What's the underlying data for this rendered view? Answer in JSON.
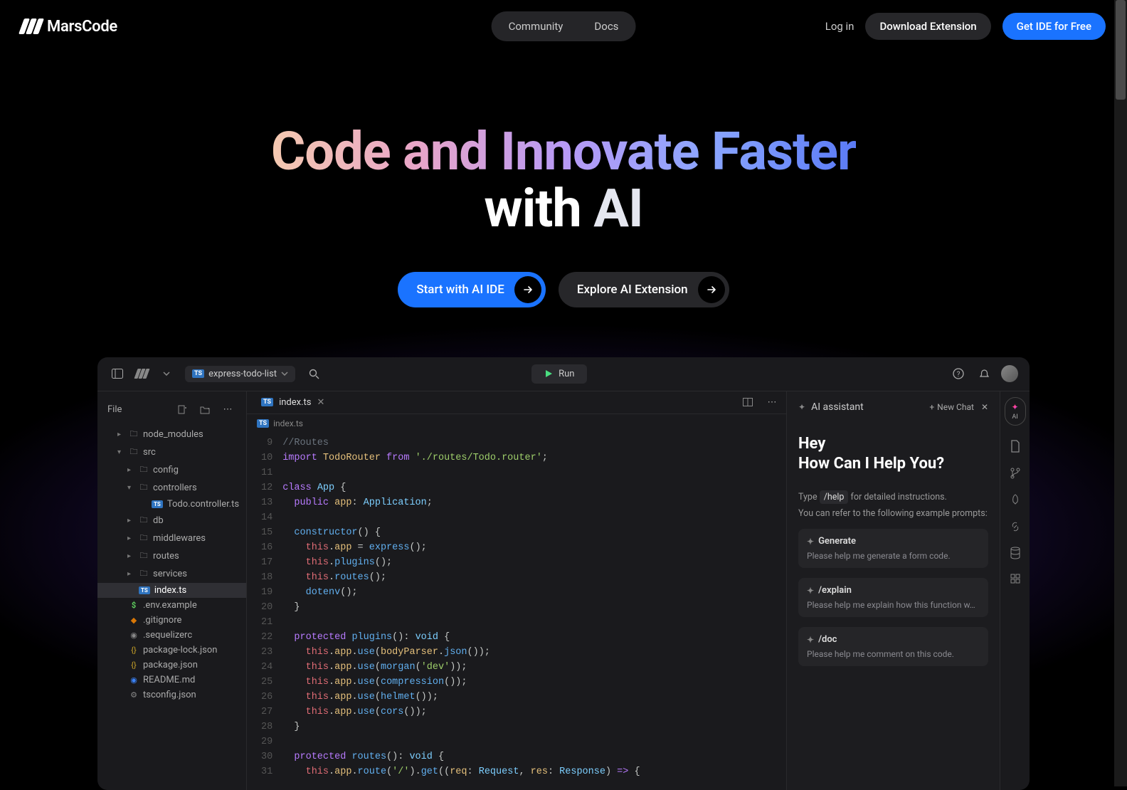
{
  "brand": "MarsCode",
  "nav": {
    "community": "Community",
    "docs": "Docs",
    "login": "Log in",
    "download": "Download Extension",
    "get_ide": "Get IDE for Free"
  },
  "hero": {
    "line1": "Code and Innovate Faster",
    "line2_a": "with ",
    "line2_b": "AI",
    "cta_primary": "Start with AI IDE",
    "cta_secondary": "Explore AI Extension"
  },
  "ide": {
    "project_name": "express-todo-list",
    "run_label": "Run",
    "explorer_title": "File",
    "file_tree": [
      {
        "name": "node_modules",
        "type": "folder",
        "indent": 1,
        "chevron": ">"
      },
      {
        "name": "src",
        "type": "folder",
        "indent": 1,
        "chevron": "v"
      },
      {
        "name": "config",
        "type": "folder",
        "indent": 2,
        "chevron": ">"
      },
      {
        "name": "controllers",
        "type": "folder",
        "indent": 2,
        "chevron": "v"
      },
      {
        "name": "Todo.controller.ts",
        "type": "ts",
        "indent": 4,
        "chevron": ""
      },
      {
        "name": "db",
        "type": "folder",
        "indent": 2,
        "chevron": ">"
      },
      {
        "name": "middlewares",
        "type": "folder",
        "indent": 2,
        "chevron": ">"
      },
      {
        "name": "routes",
        "type": "folder",
        "indent": 2,
        "chevron": ">"
      },
      {
        "name": "services",
        "type": "folder",
        "indent": 2,
        "chevron": ">"
      },
      {
        "name": "index.ts",
        "type": "ts",
        "indent": 2,
        "chevron": "",
        "active": true
      },
      {
        "name": ".env.example",
        "type": "dollar",
        "indent": 1,
        "chevron": ""
      },
      {
        "name": ".gitignore",
        "type": "git",
        "indent": 1,
        "chevron": ""
      },
      {
        "name": ".sequelizerc",
        "type": "db",
        "indent": 1,
        "chevron": ""
      },
      {
        "name": "package-lock.json",
        "type": "brace",
        "indent": 1,
        "chevron": ""
      },
      {
        "name": "package.json",
        "type": "brace",
        "indent": 1,
        "chevron": ""
      },
      {
        "name": "README.md",
        "type": "md",
        "indent": 1,
        "chevron": ""
      },
      {
        "name": "tsconfig.json",
        "type": "gear",
        "indent": 1,
        "chevron": ""
      }
    ],
    "tab_name": "index.ts",
    "breadcrumb": "index.ts",
    "code": [
      {
        "n": 9,
        "html": "<span class='tok-comment'>//Routes</span>"
      },
      {
        "n": 10,
        "html": "<span class='tok-keyword'>import</span> <span class='tok-ident'>TodoRouter</span> <span class='tok-keyword'>from</span> <span class='tok-string'>'./routes/Todo.router'</span>;"
      },
      {
        "n": 11,
        "html": ""
      },
      {
        "n": 12,
        "html": "<span class='tok-keyword'>class</span> <span class='tok-type'>App</span> {"
      },
      {
        "n": 13,
        "html": "  <span class='tok-keyword'>public</span> <span class='tok-ident'>app</span>: <span class='tok-type'>Application</span>;"
      },
      {
        "n": 14,
        "html": ""
      },
      {
        "n": 15,
        "html": "  <span class='tok-fn'>constructor</span>() {"
      },
      {
        "n": 16,
        "html": "    <span class='tok-this'>this</span>.<span class='tok-ident'>app</span> = <span class='tok-fn'>express</span>();"
      },
      {
        "n": 17,
        "html": "    <span class='tok-this'>this</span>.<span class='tok-fn'>plugins</span>();"
      },
      {
        "n": 18,
        "html": "    <span class='tok-this'>this</span>.<span class='tok-fn'>routes</span>();"
      },
      {
        "n": 19,
        "html": "    <span class='tok-fn'>dotenv</span>();"
      },
      {
        "n": 20,
        "html": "  }"
      },
      {
        "n": 21,
        "html": ""
      },
      {
        "n": 22,
        "html": "  <span class='tok-keyword'>protected</span> <span class='tok-fn'>plugins</span>(): <span class='tok-type'>void</span> {"
      },
      {
        "n": 23,
        "html": "    <span class='tok-this'>this</span>.<span class='tok-ident'>app</span>.<span class='tok-fn'>use</span>(<span class='tok-ident'>bodyParser</span>.<span class='tok-fn'>json</span>());"
      },
      {
        "n": 24,
        "html": "    <span class='tok-this'>this</span>.<span class='tok-ident'>app</span>.<span class='tok-fn'>use</span>(<span class='tok-fn'>morgan</span>(<span class='tok-string'>'dev'</span>));"
      },
      {
        "n": 25,
        "html": "    <span class='tok-this'>this</span>.<span class='tok-ident'>app</span>.<span class='tok-fn'>use</span>(<span class='tok-fn'>compression</span>());"
      },
      {
        "n": 26,
        "html": "    <span class='tok-this'>this</span>.<span class='tok-ident'>app</span>.<span class='tok-fn'>use</span>(<span class='tok-fn'>helmet</span>());"
      },
      {
        "n": 27,
        "html": "    <span class='tok-this'>this</span>.<span class='tok-ident'>app</span>.<span class='tok-fn'>use</span>(<span class='tok-fn'>cors</span>());"
      },
      {
        "n": 28,
        "html": "  }"
      },
      {
        "n": 29,
        "html": ""
      },
      {
        "n": 30,
        "html": "  <span class='tok-keyword'>protected</span> <span class='tok-fn'>routes</span>(): <span class='tok-type'>void</span> {"
      },
      {
        "n": 31,
        "html": "    <span class='tok-this'>this</span>.<span class='tok-ident'>app</span>.<span class='tok-fn'>route</span>(<span class='tok-string'>'/'</span>).<span class='tok-fn'>get</span>((<span class='tok-ident'>req</span>: <span class='tok-type'>Request</span>, <span class='tok-ident'>res</span>: <span class='tok-type'>Response</span>) <span class='tok-keyword'>=&gt;</span> {"
      }
    ],
    "ai": {
      "panel_title": "AI  assistant",
      "new_chat": "New Chat",
      "greet_1": "Hey",
      "greet_2": "How Can I Help You?",
      "help_pre": "Type",
      "help_cmd": "/help",
      "help_post": "for detailed instructions.",
      "help_sub": "You can refer to the following example prompts:",
      "prompts": [
        {
          "cmd": "Generate",
          "desc": "Please help me generate a form code."
        },
        {
          "cmd": "/explain",
          "desc": "Please help me explain how this function w…"
        },
        {
          "cmd": "/doc",
          "desc": "Please help me comment on this code."
        }
      ],
      "rail_label": "AI"
    }
  }
}
